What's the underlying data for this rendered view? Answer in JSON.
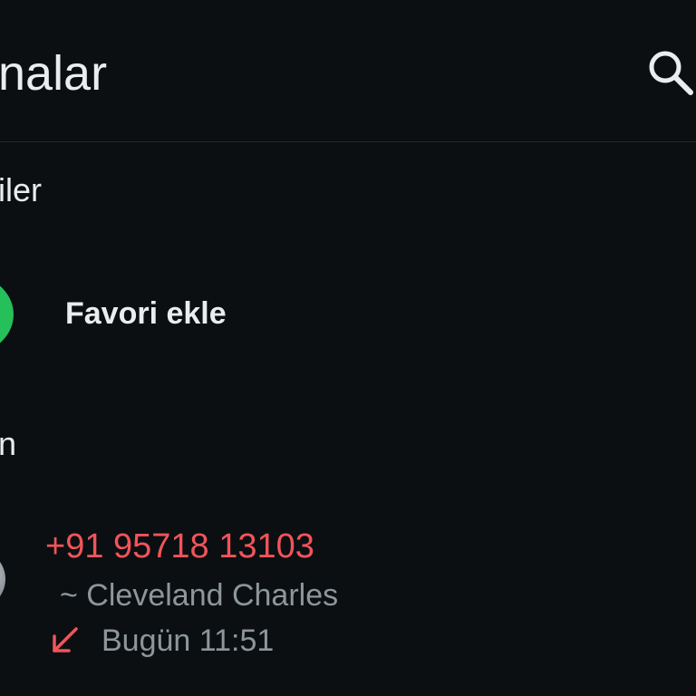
{
  "header": {
    "title": "nalar",
    "search_icon": "search-icon"
  },
  "favorites": {
    "section_label": "iler",
    "add_label": "Favori ekle"
  },
  "recent": {
    "section_label": "n",
    "calls": [
      {
        "number": "+91 95718 13103",
        "name": "~ Cleveland Charles",
        "direction_icon": "missed-incoming-arrow-icon",
        "time": "Bugün 11:51"
      }
    ]
  },
  "colors": {
    "background": "#0b0f12",
    "text_primary": "#e9edef",
    "text_secondary": "#8d969b",
    "missed_call": "#f1545a",
    "accent_green": "#25c05a"
  }
}
